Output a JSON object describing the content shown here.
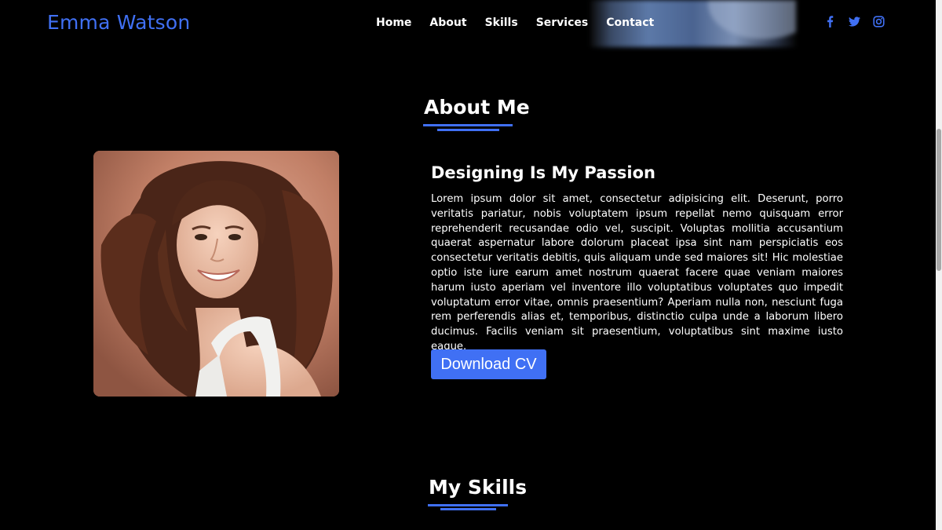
{
  "header": {
    "brand": "Emma Watson",
    "nav": [
      "Home",
      "About",
      "Skills",
      "Services",
      "Contact"
    ],
    "social_icons": [
      "facebook-icon",
      "twitter-icon",
      "instagram-icon"
    ]
  },
  "about": {
    "title": "About Me",
    "subtitle": "Designing Is My Passion",
    "paragraph": "Lorem ipsum dolor sit amet, consectetur adipisicing elit. Deserunt, porro veritatis pariatur, nobis voluptatem ipsum repellat nemo quisquam error reprehenderit recusandae odio vel, suscipit. Voluptas mollitia accusantium quaerat aspernatur labore dolorum placeat ipsa sint nam perspiciatis eos consectetur veritatis debitis, quis aliquam unde sed maiores sit! Hic molestiae optio iste iure earum amet nostrum quaerat facere quae veniam maiores harum iusto aperiam vel inventore illo voluptatibus voluptates quo impedit voluptatum error vitae, omnis praesentium? Aperiam nulla non, nesciunt fuga rem perferendis alias et, temporibus, distinctio culpa unde a laborum libero ducimus. Facilis veniam sit praesentium, voluptatibus sint maxime iusto eaque.",
    "button": "Download CV"
  },
  "skills": {
    "title": "My Skills"
  },
  "colors": {
    "accent": "#4070f4",
    "background": "#000000"
  }
}
